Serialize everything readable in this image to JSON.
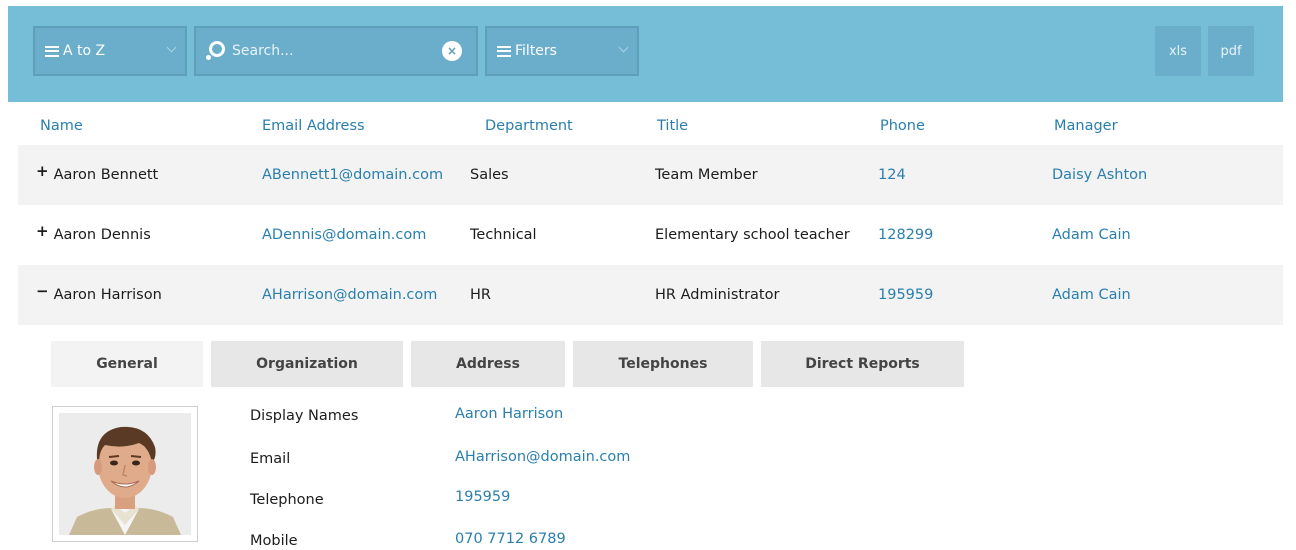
{
  "toolbar": {
    "sort_label": "A to Z",
    "search_placeholder": "Search...",
    "clear_icon": "×",
    "filters_label": "Filters",
    "xls_label": "xls",
    "pdf_label": "pdf"
  },
  "columns": [
    "Name",
    "Email Address",
    "Department",
    "Title",
    "Phone",
    "Manager"
  ],
  "rows": [
    {
      "expander": "+",
      "name": "Aaron Bennett",
      "email": "ABennett1@domain.com",
      "department": "Sales",
      "title": "Team Member",
      "phone": "124",
      "manager": "Daisy Ashton"
    },
    {
      "expander": "+",
      "name": "Aaron Dennis",
      "email": "ADennis@domain.com",
      "department": "Technical",
      "title": "Elementary school teacher",
      "phone": "128299",
      "manager": "Adam Cain"
    },
    {
      "expander": "−",
      "name": "Aaron Harrison",
      "email": "AHarrison@domain.com",
      "department": "HR",
      "title": "HR Administrator",
      "phone": "195959",
      "manager": "Adam Cain"
    }
  ],
  "detail": {
    "tabs": [
      "General",
      "Organization",
      "Address",
      "Telephones",
      "Direct Reports"
    ],
    "active_tab": "General",
    "fields": [
      {
        "label": "Display Names",
        "value": "Aaron Harrison"
      },
      {
        "label": "Email",
        "value": "AHarrison@domain.com"
      },
      {
        "label": "Telephone",
        "value": "195959"
      },
      {
        "label": "Mobile",
        "value": "070 7712 6789"
      }
    ]
  },
  "colors": {
    "toolbar_bg": "#76bdd8",
    "toolbar_control": "#6aaecb",
    "link": "#2a7fae",
    "row_shade": "#f3f3f3",
    "tab_bg": "#e7e7e7"
  }
}
